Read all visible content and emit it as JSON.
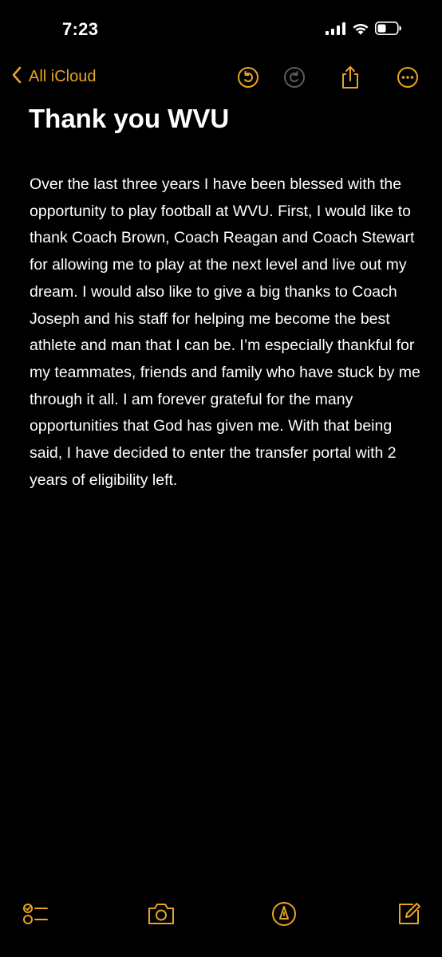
{
  "status_bar": {
    "time": "7:23",
    "icons": [
      "cellular-signal-icon",
      "wifi-icon",
      "battery-icon"
    ]
  },
  "nav": {
    "back_label": "All iCloud",
    "faded_title_text": "",
    "buttons": [
      "chevron-left-icon",
      "undo-icon",
      "redo-icon",
      "share-icon",
      "more-icon"
    ]
  },
  "note": {
    "title": "Thank you WVU",
    "body": "Over the last three years I have been blessed with the opportunity to play football at WVU. First, I would like to thank Coach Brown, Coach Reagan and Coach Stewart for allowing me to play at the next level and live out my dream.  I would also like to give a big thanks to Coach Joseph and his staff for helping me become the best athlete and man that I can be. I’m especially thankful for my teammates, friends and family who have stuck by me through it all. I am forever grateful for the many opportunities that God has given me. With that being said,  I have decided to enter the transfer portal with 2 years of eligibility left."
  },
  "toolbar": {
    "icons": [
      "checklist-icon",
      "camera-icon",
      "markup-icon",
      "compose-icon"
    ]
  },
  "colors": {
    "accent": "#E8A425",
    "background": "#000000",
    "text": "#FFFFFF"
  }
}
